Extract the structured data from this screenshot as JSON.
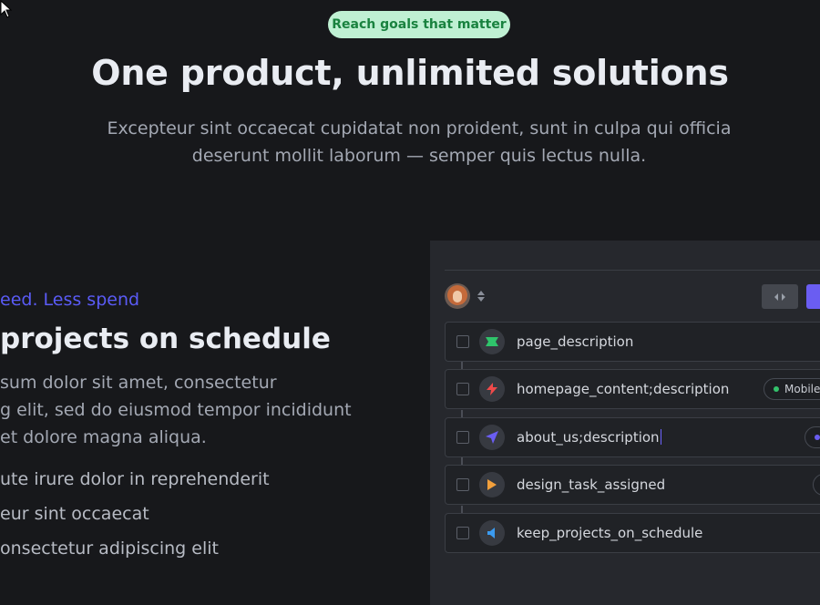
{
  "hero": {
    "badge": "Reach goals that matter",
    "title": "One product, unlimited solutions",
    "subtitle_line1": "Excepteur sint occaecat cupidatat non proident, sunt in culpa qui officia",
    "subtitle_line2": "deserunt mollit laborum — semper quis lectus nulla."
  },
  "feature": {
    "eyebrow": "eed. Less spend",
    "title": "projects on schedule",
    "body": [
      "sum dolor sit amet, consectetur",
      "g elit, sed do eiusmod tempor incididunt",
      "et dolore magna aliqua."
    ],
    "bullets": [
      "ute irure dolor in reprehenderit",
      "eur sint occaecat",
      "onsectetur adipiscing elit"
    ]
  },
  "panel": {
    "rows": [
      {
        "label": "page_description",
        "icon": "ticket-icon",
        "icon_color": "#2fc46b"
      },
      {
        "label": "homepage_content;description",
        "icon": "lightning-icon",
        "icon_color": "#ef4a4a",
        "tag": "Mobile",
        "tag_dot_color": "#34c26b"
      },
      {
        "label": "about_us;description",
        "icon": "navigation-arrow-icon",
        "icon_color": "#6a5df2",
        "tag_dot_color": "#6a5df2",
        "editing": true
      },
      {
        "label": "design_task_assigned",
        "icon": "play-icon",
        "icon_color": "#f2a03c"
      },
      {
        "label": "keep_projects_on_schedule",
        "icon": "speaker-icon",
        "icon_color": "#3b9bf0"
      }
    ]
  },
  "colors": {
    "background": "#17181b",
    "accent": "#5a5bf6",
    "badge_bg": "#bff0d3",
    "badge_text": "#19823f",
    "panel_bg": "#26282d"
  }
}
